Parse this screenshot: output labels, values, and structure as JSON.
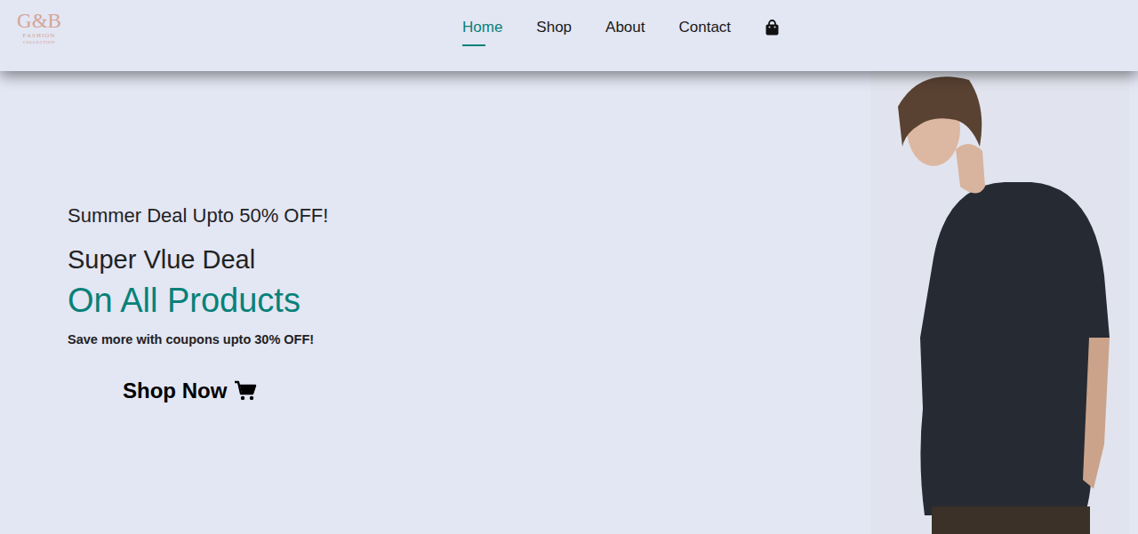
{
  "logo": {
    "mark": "G&B",
    "line1": "FASHION",
    "line2": "COLLECTION"
  },
  "nav": [
    {
      "label": "Home",
      "selected": true
    },
    {
      "label": "Shop",
      "selected": false
    },
    {
      "label": "About",
      "selected": false
    },
    {
      "label": "Contact",
      "selected": false
    }
  ],
  "hero": {
    "kicker": "Summer Deal Upto 50% OFF!",
    "title": "Super Vlue Deal",
    "highlight": "On All Products",
    "note": "Save more with coupons upto 30% OFF!",
    "button": "Shop Now"
  }
}
